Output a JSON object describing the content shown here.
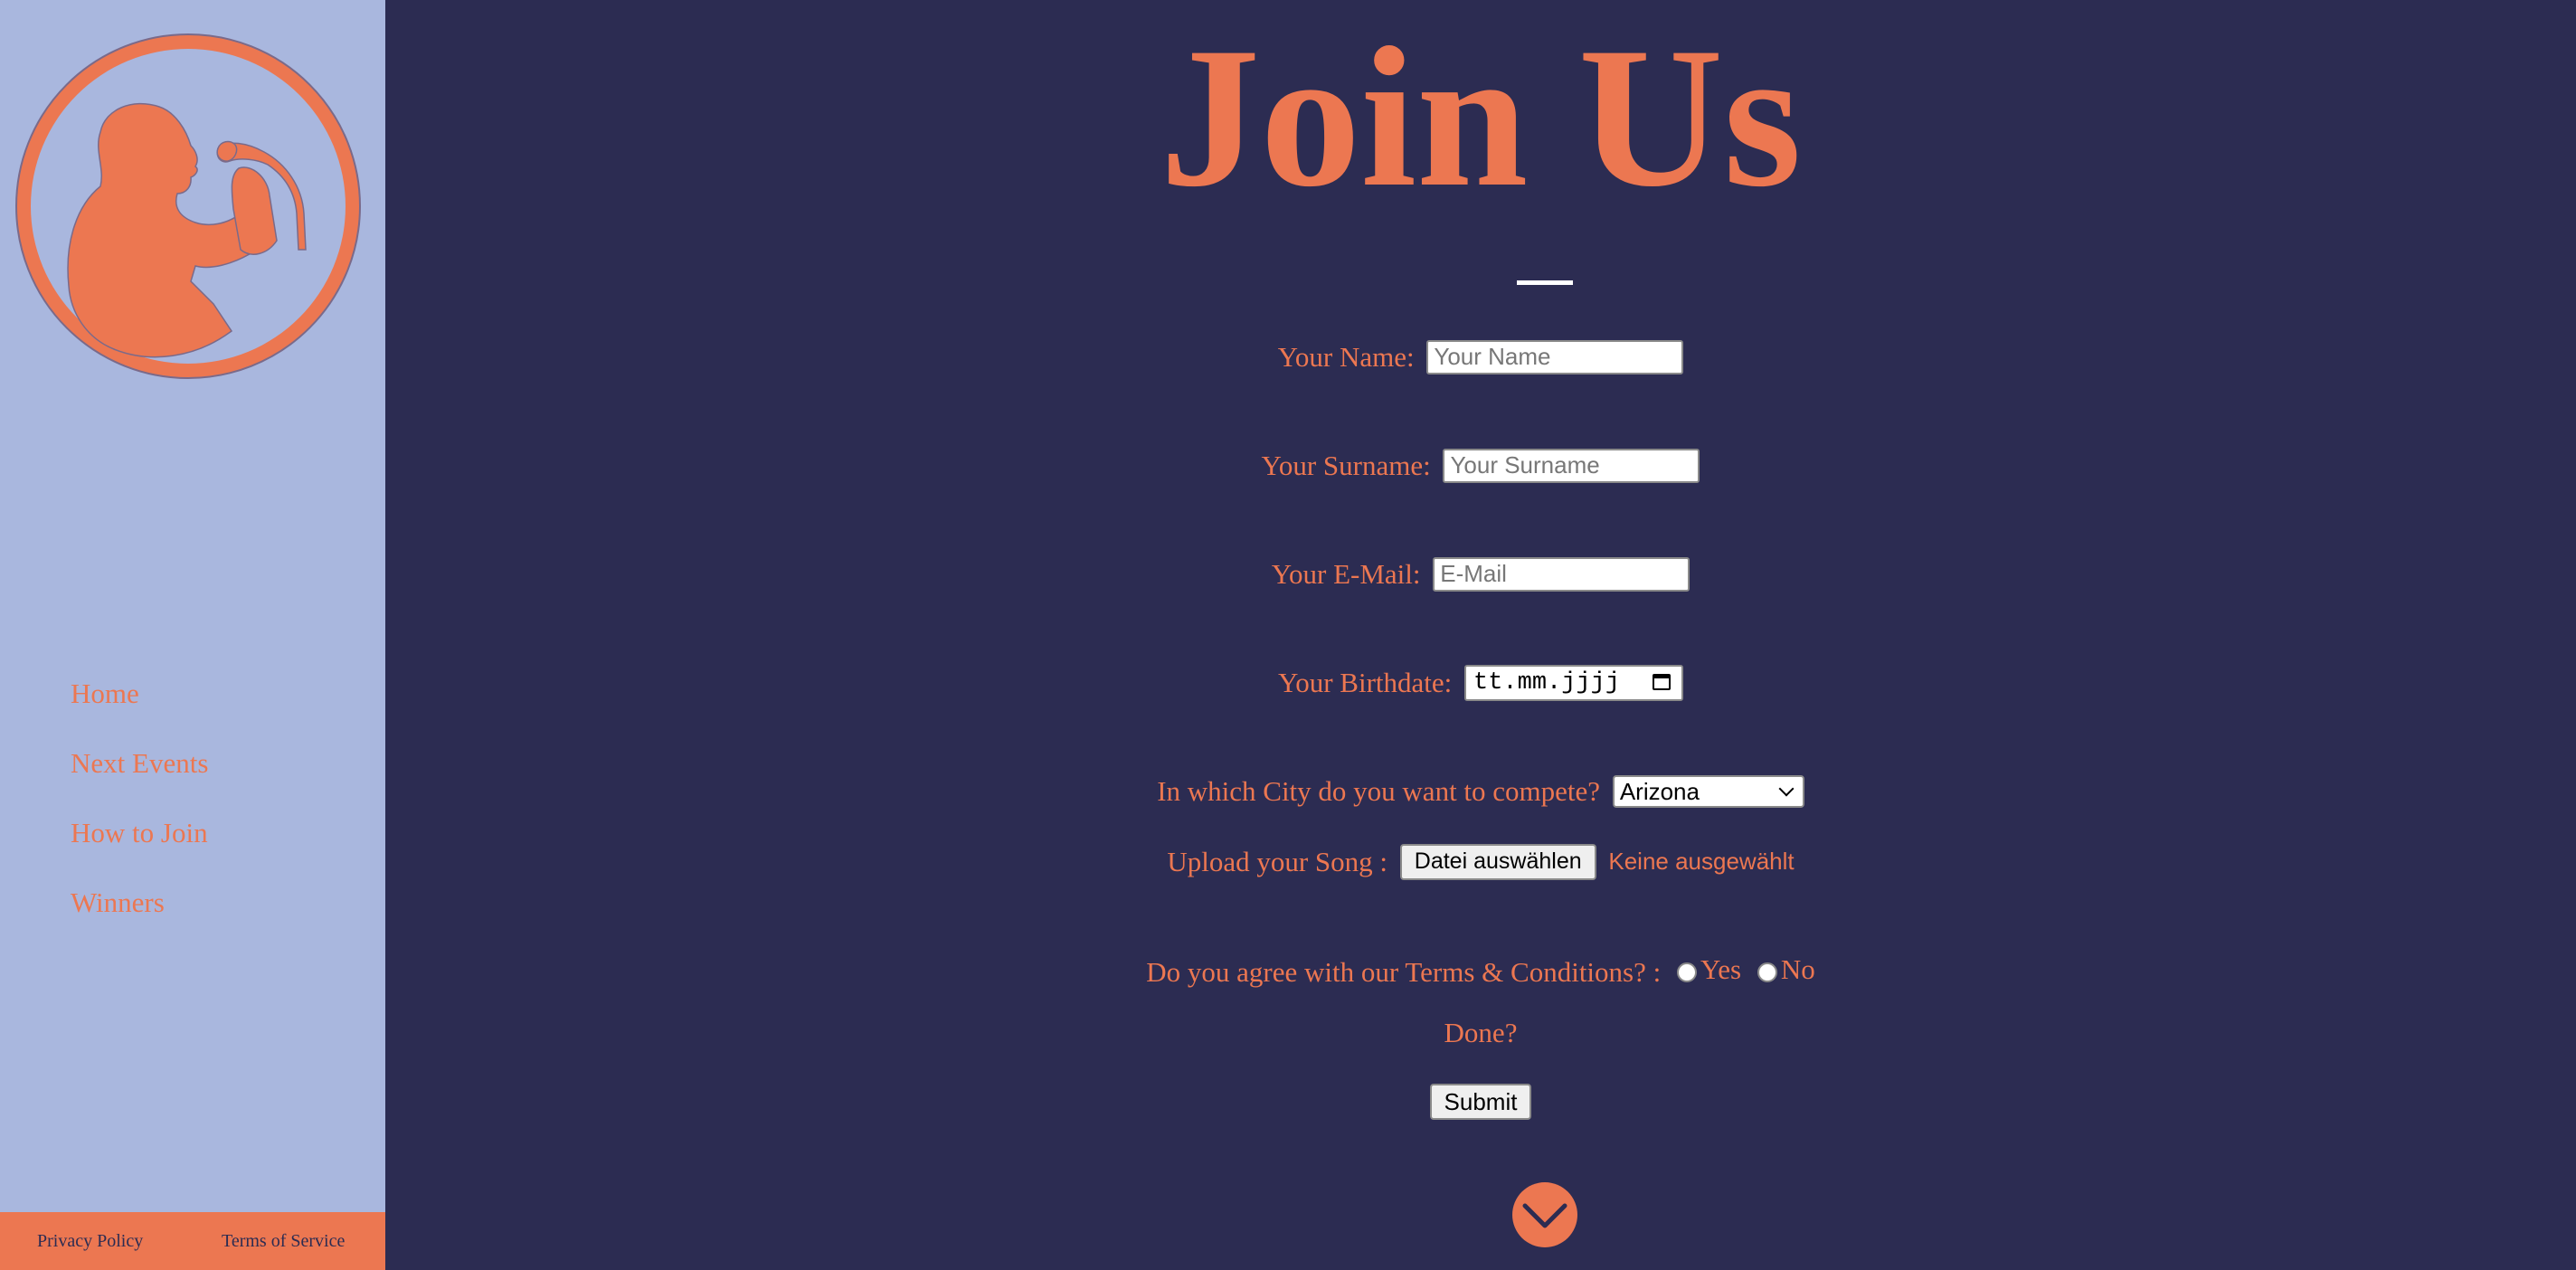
{
  "sidebar": {
    "logo_icon": "singer-silhouette-logo",
    "nav_items": [
      {
        "label": "Home"
      },
      {
        "label": "Next Events"
      },
      {
        "label": "How to Join"
      },
      {
        "label": "Winners"
      }
    ],
    "footer": {
      "privacy": "Privacy Policy",
      "terms": "Terms of Service"
    }
  },
  "main": {
    "title": "Join Us",
    "form": {
      "name": {
        "label": "Your Name:",
        "placeholder": "Your Name",
        "value": ""
      },
      "surname": {
        "label": "Your Surname:",
        "placeholder": "Your Surname",
        "value": ""
      },
      "email": {
        "label": "Your E-Mail:",
        "placeholder": "E-Mail",
        "value": ""
      },
      "birthdate": {
        "label": "Your Birthdate:",
        "placeholder": "tt.mm.jjjj",
        "icon": "calendar-icon"
      },
      "city": {
        "label": "In which City do you want to compete?",
        "selected": "Arizona"
      },
      "song": {
        "label": "Upload your Song :",
        "button": "Datei auswählen",
        "status": "Keine ausgewählt"
      },
      "terms": {
        "label": "Do you agree with our Terms & Conditions? :",
        "yes": "Yes",
        "no": "No"
      },
      "done": "Done?",
      "submit": "Submit"
    },
    "scroll_icon": "chevron-down-icon"
  },
  "colors": {
    "background": "#2c2c52",
    "sidebar": "#a9b7de",
    "accent": "#ec7751",
    "divider": "#ffffff"
  }
}
